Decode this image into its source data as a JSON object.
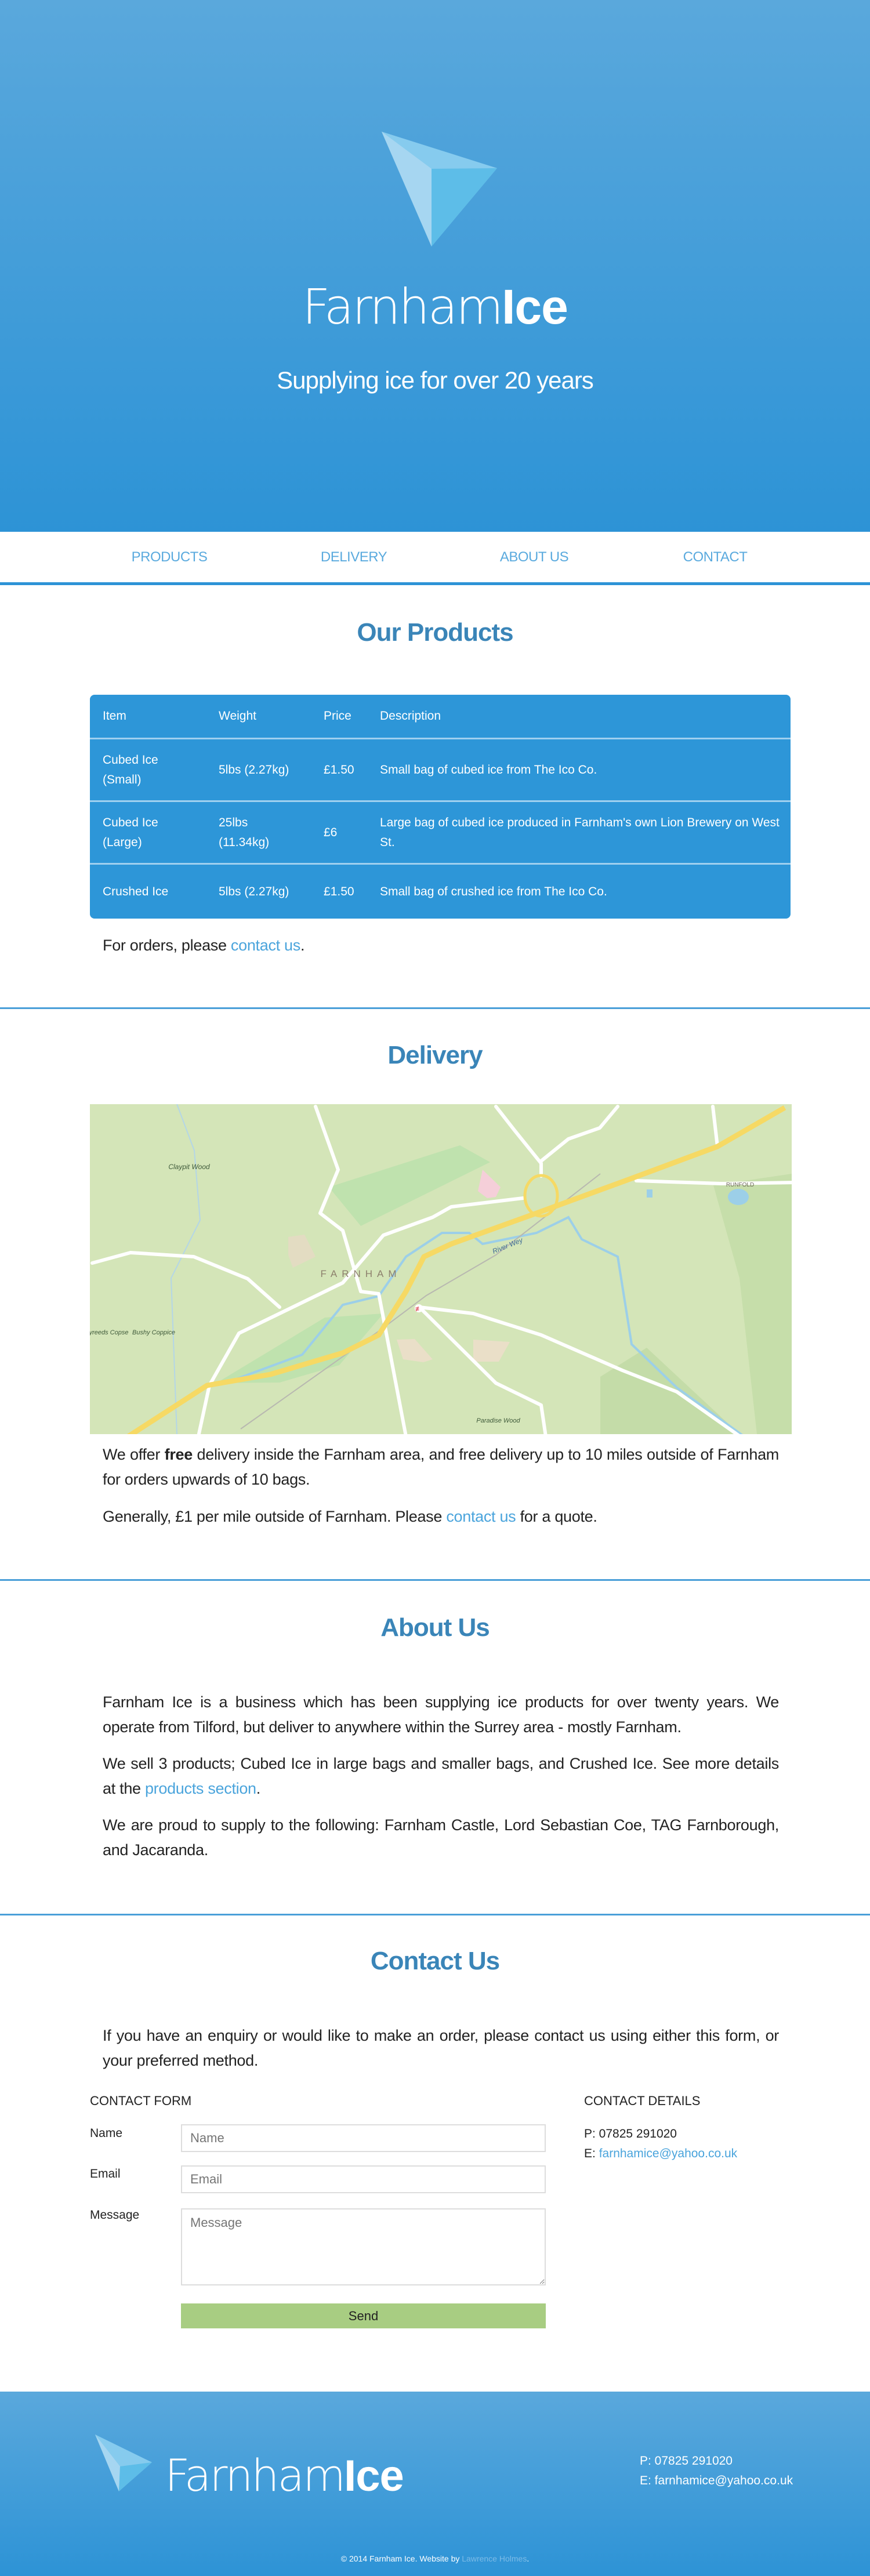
{
  "brand": {
    "name_light": "Farnham",
    "name_bold": "Ice",
    "tagline": "Supplying ice for over 20 years"
  },
  "colors": {
    "primary": "#2d93d6",
    "link": "#4aa4dc",
    "send": "#a8cd82"
  },
  "nav": [
    "PRODUCTS",
    "DELIVERY",
    "ABOUT US",
    "CONTACT"
  ],
  "products": {
    "title": "Our Products",
    "headers": [
      "Item",
      "Weight",
      "Price",
      "Description"
    ],
    "rows": [
      [
        "Cubed Ice (Small)",
        "5lbs (2.27kg)",
        "£1.50",
        "Small bag of cubed ice from The Ico Co."
      ],
      [
        "Cubed Ice (Large)",
        "25lbs (11.34kg)",
        "£6",
        "Large bag of cubed ice produced in Farnham's own Lion Brewery on West St."
      ],
      [
        "Crushed Ice",
        "5lbs (2.27kg)",
        "£1.50",
        "Small bag of crushed ice from The Ico Co."
      ]
    ],
    "orders_pre": "For orders, please ",
    "orders_link": "contact us",
    "orders_post": "."
  },
  "delivery": {
    "title": "Delivery",
    "map_labels": {
      "claypit": "Claypit Wood",
      "farnham": "FARNHAM",
      "river": "River Wey",
      "bushyreeds": "Bushyreeds Copse",
      "bushy": "Bushy Coppice",
      "runfold": "RUNFOLD",
      "paradise": "Paradise Wood"
    },
    "p1_pre": "We offer ",
    "p1_bold": "free",
    "p1_post": " delivery inside the Farnham area, and free delivery up to 10 miles outside of Farnham for orders upwards of 10 bags.",
    "p2_pre": "Generally, £1 per mile outside of Farnham. Please ",
    "p2_link": "contact us",
    "p2_post": " for a quote."
  },
  "about": {
    "title": "About Us",
    "p1": "Farnham Ice is a business which has been supplying ice products for over twenty years. We operate from Tilford, but deliver to anywhere within the Surrey area - mostly Farnham.",
    "p2_pre": "We sell 3 products; Cubed Ice in large bags and smaller bags, and Crushed Ice. See more details at the ",
    "p2_link": "products section",
    "p2_post": ".",
    "p3": "We are proud to supply to the following: Farnham Castle, Lord Sebastian Coe, TAG Farnborough, and Jacaranda."
  },
  "contact": {
    "title": "Contact Us",
    "intro": "If you have an enquiry or would like to make an order, please contact us using either this form, or your preferred method.",
    "form_heading": "CONTACT FORM",
    "details_heading": "CONTACT DETAILS",
    "name_label": "Name",
    "name_placeholder": "Name",
    "email_label": "Email",
    "email_placeholder": "Email",
    "message_label": "Message",
    "message_placeholder": "Message",
    "send": "Send",
    "phone": "P: 07825 291020",
    "email_prefix": "E: ",
    "email": "farnhamice@yahoo.co.uk"
  },
  "footer": {
    "phone": "P: 07825 291020",
    "email": "E: farnhamice@yahoo.co.uk",
    "copy": "© 2014 Farnham Ice. Website by ",
    "author": "Lawrence Holmes",
    "copy_end": "."
  }
}
